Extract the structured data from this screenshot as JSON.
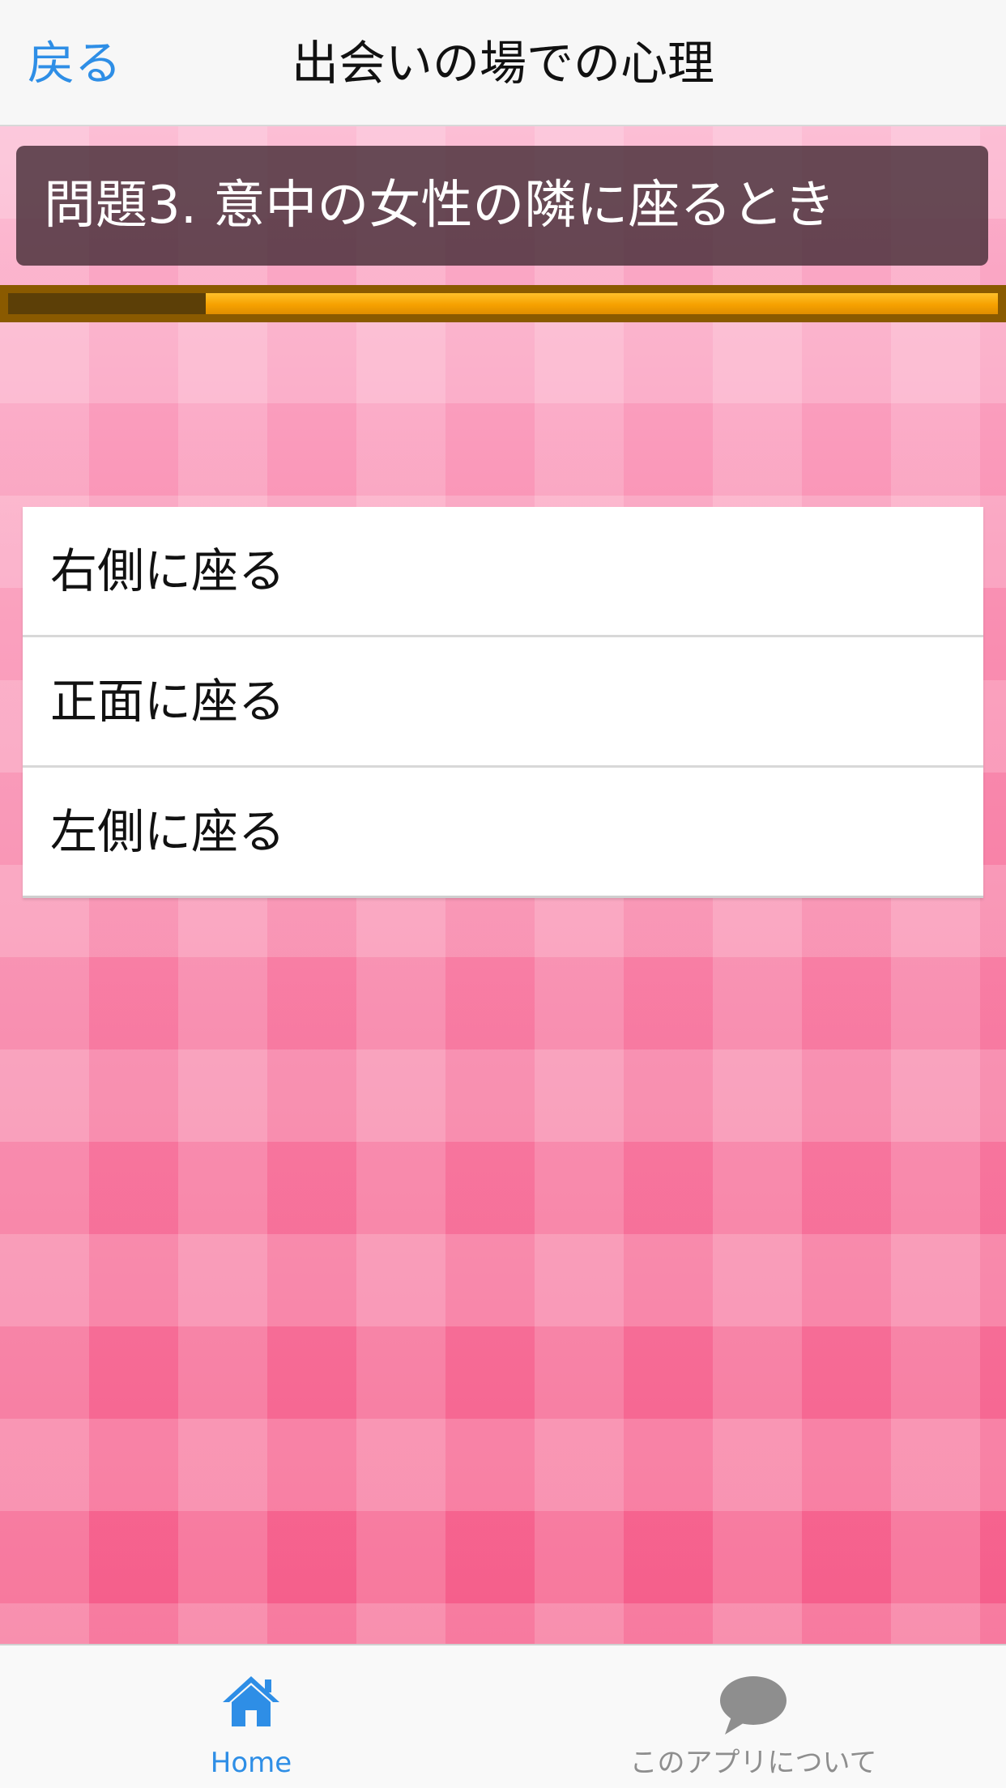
{
  "navbar": {
    "back_label": "戻る",
    "title": "出会いの場での心理"
  },
  "question": {
    "text": "問題3. 意中の女性の隣に座るとき"
  },
  "progress": {
    "fraction": 0.2
  },
  "options": [
    {
      "label": "右側に座る"
    },
    {
      "label": "正面に座る"
    },
    {
      "label": "左側に座る"
    }
  ],
  "tabbar": {
    "home_label": "Home",
    "about_label": "このアプリについて",
    "home_icon": "home-icon",
    "about_icon": "speech-bubble-icon",
    "active_color": "#2e8ee6",
    "inactive_color": "#8e8e8e"
  },
  "colors": {
    "accent": "#2e8ee6",
    "progress_fill": "#f6a100",
    "progress_done": "#5c3f07"
  }
}
